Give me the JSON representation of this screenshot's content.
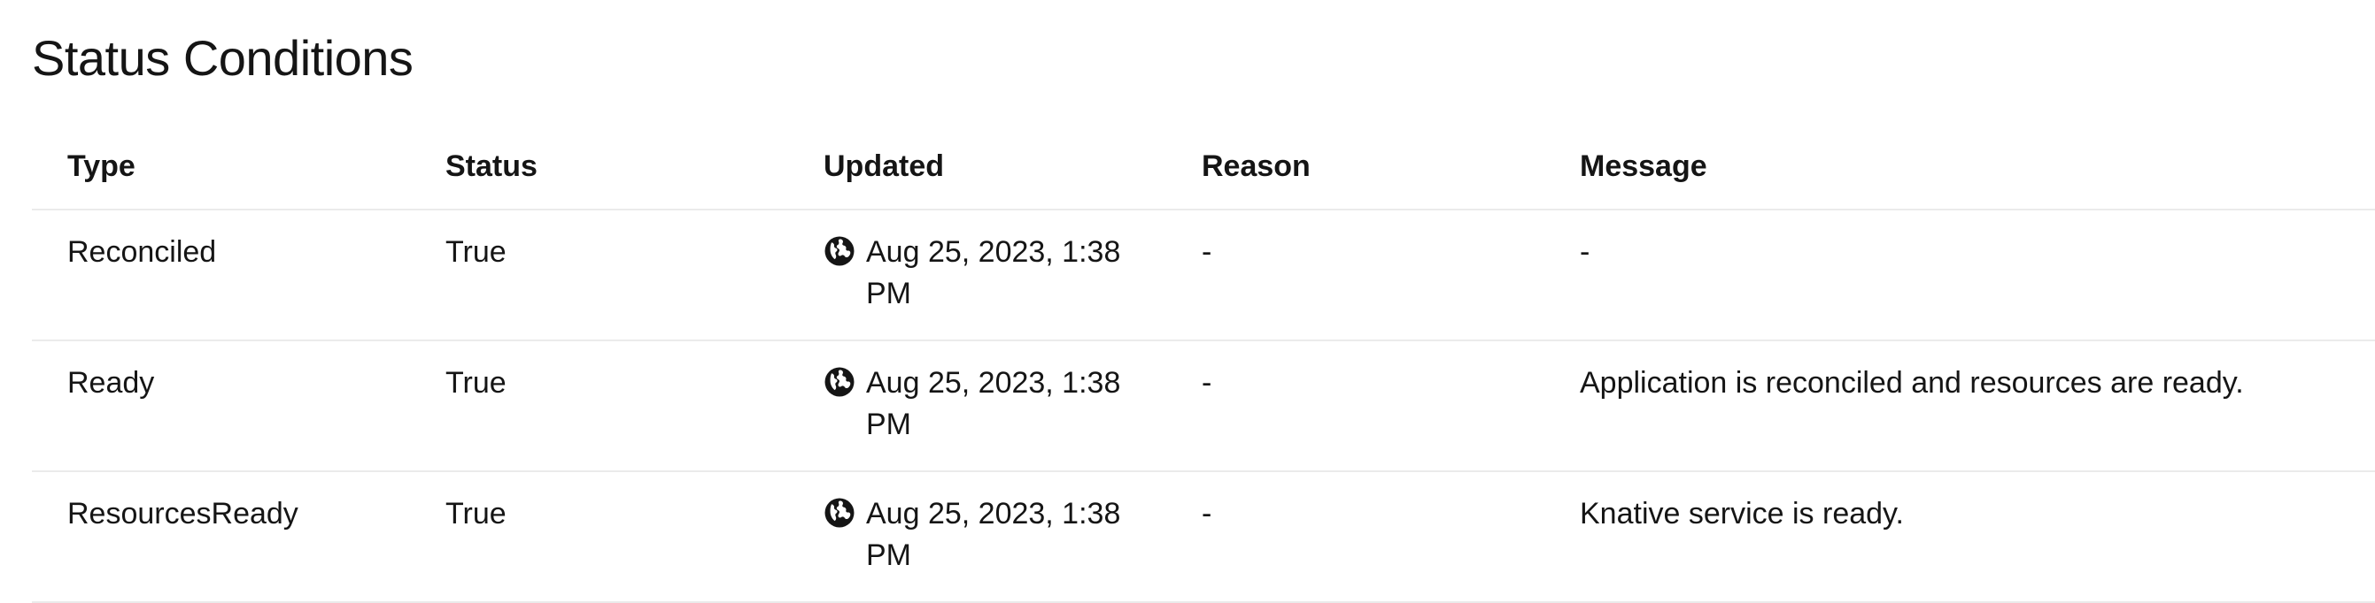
{
  "section": {
    "title": "Status Conditions"
  },
  "table": {
    "headers": {
      "type": "Type",
      "status": "Status",
      "updated": "Updated",
      "reason": "Reason",
      "message": "Message"
    },
    "rows": [
      {
        "type": "Reconciled",
        "status": "True",
        "updated_icon": "globe-icon",
        "updated": "Aug 25, 2023, 1:38 PM",
        "reason": "-",
        "message": "-"
      },
      {
        "type": "Ready",
        "status": "True",
        "updated_icon": "globe-icon",
        "updated": "Aug 25, 2023, 1:38 PM",
        "reason": "-",
        "message": "Application is reconciled and resources are ready."
      },
      {
        "type": "ResourcesReady",
        "status": "True",
        "updated_icon": "globe-icon",
        "updated": "Aug 25, 2023, 1:38 PM",
        "reason": "-",
        "message": "Knative service is ready."
      }
    ]
  },
  "colors": {
    "text": "#151515",
    "border": "#ebebeb",
    "background": "#ffffff"
  }
}
